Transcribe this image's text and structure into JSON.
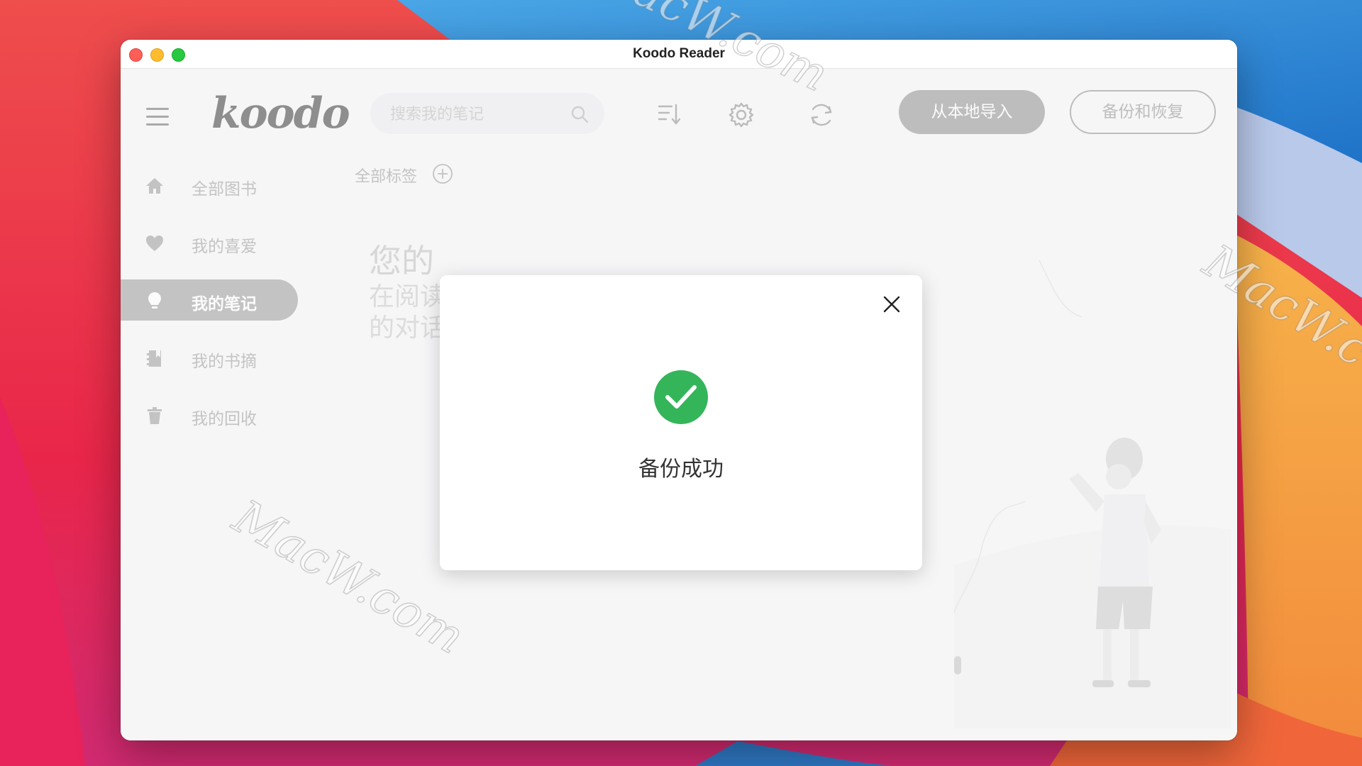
{
  "window": {
    "title": "Koodo Reader"
  },
  "header": {
    "logo": "koodo",
    "search_placeholder": "搜索我的笔记",
    "import_label": "从本地导入",
    "backup_label": "备份和恢复",
    "icons": [
      "sort-icon",
      "settings-icon",
      "sync-icon"
    ]
  },
  "sidebar": {
    "items": [
      {
        "label": "全部图书",
        "icon": "home-icon",
        "active": false
      },
      {
        "label": "我的喜爱",
        "icon": "heart-icon",
        "active": false
      },
      {
        "label": "我的笔记",
        "icon": "bulb-icon",
        "active": true
      },
      {
        "label": "我的书摘",
        "icon": "bookmark-book-icon",
        "active": false
      },
      {
        "label": "我的回收",
        "icon": "trash-icon",
        "active": false
      }
    ]
  },
  "tags": {
    "label": "全部标签"
  },
  "empty": {
    "title": "您的",
    "line1": "在阅读",
    "line2": "的对话"
  },
  "modal": {
    "message": "备份成功",
    "status_color": "#34b55a"
  },
  "watermarks": [
    "MacW.com",
    "MacW.com",
    "MacW.c"
  ],
  "colors": {
    "active_item": "#9a9a9a",
    "success": "#34b55a"
  }
}
